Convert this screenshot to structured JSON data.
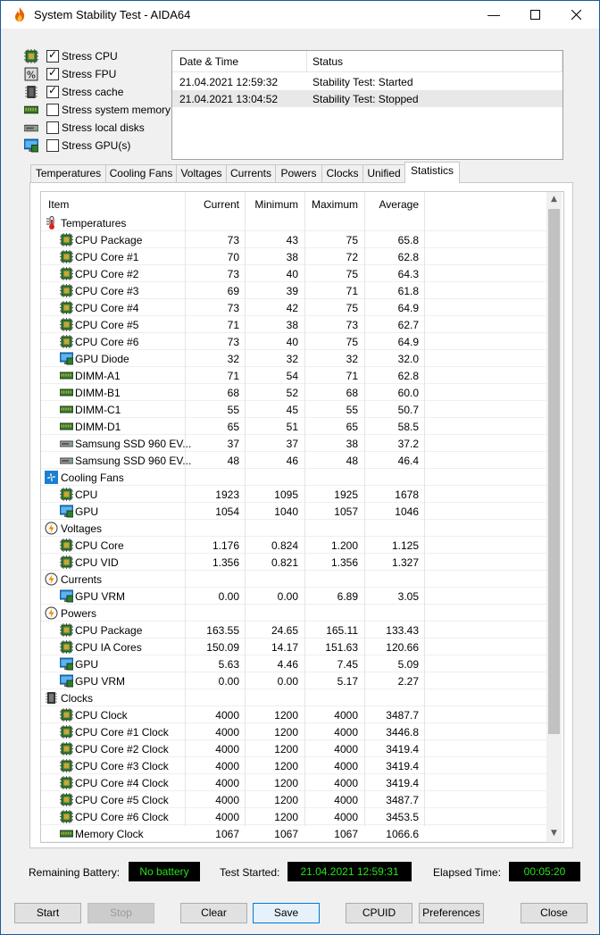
{
  "window": {
    "title": "System Stability Test - AIDA64"
  },
  "stress_options": [
    {
      "label": "Stress CPU",
      "checked": true,
      "icon": "cpu-chip-icon"
    },
    {
      "label": "Stress FPU",
      "checked": true,
      "icon": "fpu-icon"
    },
    {
      "label": "Stress cache",
      "checked": true,
      "icon": "cache-icon"
    },
    {
      "label": "Stress system memory",
      "checked": false,
      "icon": "memory-icon"
    },
    {
      "label": "Stress local disks",
      "checked": false,
      "icon": "disk-icon"
    },
    {
      "label": "Stress GPU(s)",
      "checked": false,
      "icon": "monitor-icon"
    }
  ],
  "log": {
    "columns": [
      "Date & Time",
      "Status"
    ],
    "rows": [
      {
        "datetime": "21.04.2021 12:59:32",
        "status": "Stability Test: Started"
      },
      {
        "datetime": "21.04.2021 13:04:52",
        "status": "Stability Test: Stopped"
      }
    ]
  },
  "tabs": [
    "Temperatures",
    "Cooling Fans",
    "Voltages",
    "Currents",
    "Powers",
    "Clocks",
    "Unified",
    "Statistics"
  ],
  "active_tab": "Statistics",
  "stats": {
    "columns": [
      "Item",
      "Current",
      "Minimum",
      "Maximum",
      "Average"
    ],
    "rows": [
      {
        "group": true,
        "name": "Temperatures",
        "icon": "thermometer-icon"
      },
      {
        "name": "CPU Package",
        "icon": "cpu-chip-icon",
        "cur": "73",
        "min": "43",
        "max": "75",
        "avg": "65.8"
      },
      {
        "name": "CPU Core #1",
        "icon": "cpu-chip-icon",
        "cur": "70",
        "min": "38",
        "max": "72",
        "avg": "62.8"
      },
      {
        "name": "CPU Core #2",
        "icon": "cpu-chip-icon",
        "cur": "73",
        "min": "40",
        "max": "75",
        "avg": "64.3"
      },
      {
        "name": "CPU Core #3",
        "icon": "cpu-chip-icon",
        "cur": "69",
        "min": "39",
        "max": "71",
        "avg": "61.8"
      },
      {
        "name": "CPU Core #4",
        "icon": "cpu-chip-icon",
        "cur": "73",
        "min": "42",
        "max": "75",
        "avg": "64.9"
      },
      {
        "name": "CPU Core #5",
        "icon": "cpu-chip-icon",
        "cur": "71",
        "min": "38",
        "max": "73",
        "avg": "62.7"
      },
      {
        "name": "CPU Core #6",
        "icon": "cpu-chip-icon",
        "cur": "73",
        "min": "40",
        "max": "75",
        "avg": "64.9"
      },
      {
        "name": "GPU Diode",
        "icon": "monitor-icon",
        "cur": "32",
        "min": "32",
        "max": "32",
        "avg": "32.0"
      },
      {
        "name": "DIMM-A1",
        "icon": "memory-icon",
        "cur": "71",
        "min": "54",
        "max": "71",
        "avg": "62.8"
      },
      {
        "name": "DIMM-B1",
        "icon": "memory-icon",
        "cur": "68",
        "min": "52",
        "max": "68",
        "avg": "60.0"
      },
      {
        "name": "DIMM-C1",
        "icon": "memory-icon",
        "cur": "55",
        "min": "45",
        "max": "55",
        "avg": "50.7"
      },
      {
        "name": "DIMM-D1",
        "icon": "memory-icon",
        "cur": "65",
        "min": "51",
        "max": "65",
        "avg": "58.5"
      },
      {
        "name": "Samsung SSD 960 EV...",
        "icon": "disk-icon",
        "cur": "37",
        "min": "37",
        "max": "38",
        "avg": "37.2"
      },
      {
        "name": "Samsung SSD 960 EV...",
        "icon": "disk-icon",
        "cur": "48",
        "min": "46",
        "max": "48",
        "avg": "46.4"
      },
      {
        "group": true,
        "name": "Cooling Fans",
        "icon": "fan-icon"
      },
      {
        "name": "CPU",
        "icon": "cpu-chip-icon",
        "cur": "1923",
        "min": "1095",
        "max": "1925",
        "avg": "1678"
      },
      {
        "name": "GPU",
        "icon": "monitor-icon",
        "cur": "1054",
        "min": "1040",
        "max": "1057",
        "avg": "1046"
      },
      {
        "group": true,
        "name": "Voltages",
        "icon": "lightning-icon"
      },
      {
        "name": "CPU Core",
        "icon": "cpu-chip-icon",
        "cur": "1.176",
        "min": "0.824",
        "max": "1.200",
        "avg": "1.125"
      },
      {
        "name": "CPU VID",
        "icon": "cpu-chip-icon",
        "cur": "1.356",
        "min": "0.821",
        "max": "1.356",
        "avg": "1.327"
      },
      {
        "group": true,
        "name": "Currents",
        "icon": "lightning-icon"
      },
      {
        "name": "GPU VRM",
        "icon": "monitor-icon",
        "cur": "0.00",
        "min": "0.00",
        "max": "6.89",
        "avg": "3.05"
      },
      {
        "group": true,
        "name": "Powers",
        "icon": "lightning-icon"
      },
      {
        "name": "CPU Package",
        "icon": "cpu-chip-icon",
        "cur": "163.55",
        "min": "24.65",
        "max": "165.11",
        "avg": "133.43"
      },
      {
        "name": "CPU IA Cores",
        "icon": "cpu-chip-icon",
        "cur": "150.09",
        "min": "14.17",
        "max": "151.63",
        "avg": "120.66"
      },
      {
        "name": "GPU",
        "icon": "monitor-icon",
        "cur": "5.63",
        "min": "4.46",
        "max": "7.45",
        "avg": "5.09"
      },
      {
        "name": "GPU VRM",
        "icon": "monitor-icon",
        "cur": "0.00",
        "min": "0.00",
        "max": "5.17",
        "avg": "2.27"
      },
      {
        "group": true,
        "name": "Clocks",
        "icon": "clock-chip-icon"
      },
      {
        "name": "CPU Clock",
        "icon": "cpu-chip-icon",
        "cur": "4000",
        "min": "1200",
        "max": "4000",
        "avg": "3487.7"
      },
      {
        "name": "CPU Core #1 Clock",
        "icon": "cpu-chip-icon",
        "cur": "4000",
        "min": "1200",
        "max": "4000",
        "avg": "3446.8"
      },
      {
        "name": "CPU Core #2 Clock",
        "icon": "cpu-chip-icon",
        "cur": "4000",
        "min": "1200",
        "max": "4000",
        "avg": "3419.4"
      },
      {
        "name": "CPU Core #3 Clock",
        "icon": "cpu-chip-icon",
        "cur": "4000",
        "min": "1200",
        "max": "4000",
        "avg": "3419.4"
      },
      {
        "name": "CPU Core #4 Clock",
        "icon": "cpu-chip-icon",
        "cur": "4000",
        "min": "1200",
        "max": "4000",
        "avg": "3419.4"
      },
      {
        "name": "CPU Core #5 Clock",
        "icon": "cpu-chip-icon",
        "cur": "4000",
        "min": "1200",
        "max": "4000",
        "avg": "3487.7"
      },
      {
        "name": "CPU Core #6 Clock",
        "icon": "cpu-chip-icon",
        "cur": "4000",
        "min": "1200",
        "max": "4000",
        "avg": "3453.5"
      },
      {
        "name": "Memory Clock",
        "icon": "memory-icon",
        "cur": "1067",
        "min": "1067",
        "max": "1067",
        "avg": "1066.6"
      }
    ]
  },
  "status_bar": {
    "battery_label": "Remaining Battery:",
    "battery_value": "No battery",
    "started_label": "Test Started:",
    "started_value": "21.04.2021 12:59:31",
    "elapsed_label": "Elapsed Time:",
    "elapsed_value": "00:05:20"
  },
  "buttons": {
    "start": "Start",
    "stop": "Stop",
    "clear": "Clear",
    "save": "Save",
    "cpuid": "CPUID",
    "preferences": "Preferences",
    "close": "Close"
  },
  "colors": {
    "status_text": "#27e21c",
    "accent": "#0078d7"
  }
}
